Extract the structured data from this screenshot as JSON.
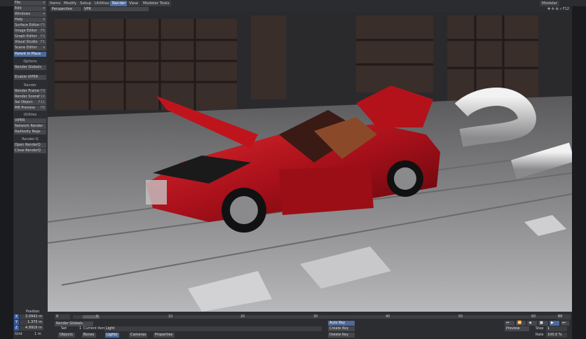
{
  "tabs": [
    "Items",
    "Modify",
    "Setup",
    "Utilities",
    "Render",
    "View",
    "Modeler Tools"
  ],
  "active_tab": "Render",
  "window": {
    "modeler_label": "Modeler",
    "f_label": "F12"
  },
  "viewport": {
    "view_mode": "Perspective",
    "shading": "VPR"
  },
  "sidebar": {
    "menus": [
      {
        "label": "File",
        "key": ""
      },
      {
        "label": "Edit",
        "key": ""
      },
      {
        "label": "Windows",
        "key": ""
      },
      {
        "label": "Help",
        "key": ""
      },
      {
        "label": "Surface Editor",
        "key": "F5"
      },
      {
        "label": "Image Editor",
        "key": "F6"
      },
      {
        "label": "Graph Editor",
        "key": "F2"
      },
      {
        "label": "Visual Studio",
        "key": "F1"
      },
      {
        "label": "Scene Editor",
        "key": ""
      }
    ],
    "parent_in_place": "Parent in Place",
    "options_header": "Options",
    "options": [
      "Render Globals",
      "Enable VIPER"
    ],
    "render_header": "Render",
    "render": [
      {
        "label": "Render Frame",
        "key": "F9"
      },
      {
        "label": "Render Scene",
        "key": "F10"
      },
      {
        "label": "Sel Object",
        "key": "F11"
      },
      {
        "label": "MB Preview",
        "key": "F8"
      }
    ],
    "utilities_header": "Utilities",
    "utilities": [
      "VIPER",
      "Network Render",
      "Radiosity Regs"
    ],
    "renderq_header": "Render-Q",
    "renderq": [
      "Open RenderQ",
      "Close RenderQ"
    ]
  },
  "bottom": {
    "position_label": "Position",
    "x_label": "X",
    "x_value": "3.0942 m",
    "y_label": "Y",
    "y_value": "1.375 m",
    "z_label": "Z",
    "z_value": "4.9916 m",
    "grid_label": "Grid",
    "grid_value": "1 m",
    "frame_value": "0",
    "render_globals": "Render Globals",
    "set_label": "Set",
    "set_value": "1",
    "current_item_label": "Current Item",
    "current_item_value": "Light",
    "auto_key": "Auto Key",
    "create_key": "Create Key",
    "delete_key": "Delete Key",
    "objects": "Objects",
    "bones": "Bones",
    "lights": "Lights",
    "cameras": "Cameras",
    "properties": "Properties",
    "preview": "Preview",
    "step_label": "Step",
    "step_value": "1",
    "rate_label": "Rate",
    "rate_value": "100.0 %",
    "end_frame": "60",
    "ticks": [
      "0",
      "10",
      "20",
      "30",
      "40",
      "50",
      "60"
    ]
  },
  "colors": {
    "accent": "#4d6a9c",
    "car": "#b3121a",
    "panel": "#2b2d31"
  }
}
